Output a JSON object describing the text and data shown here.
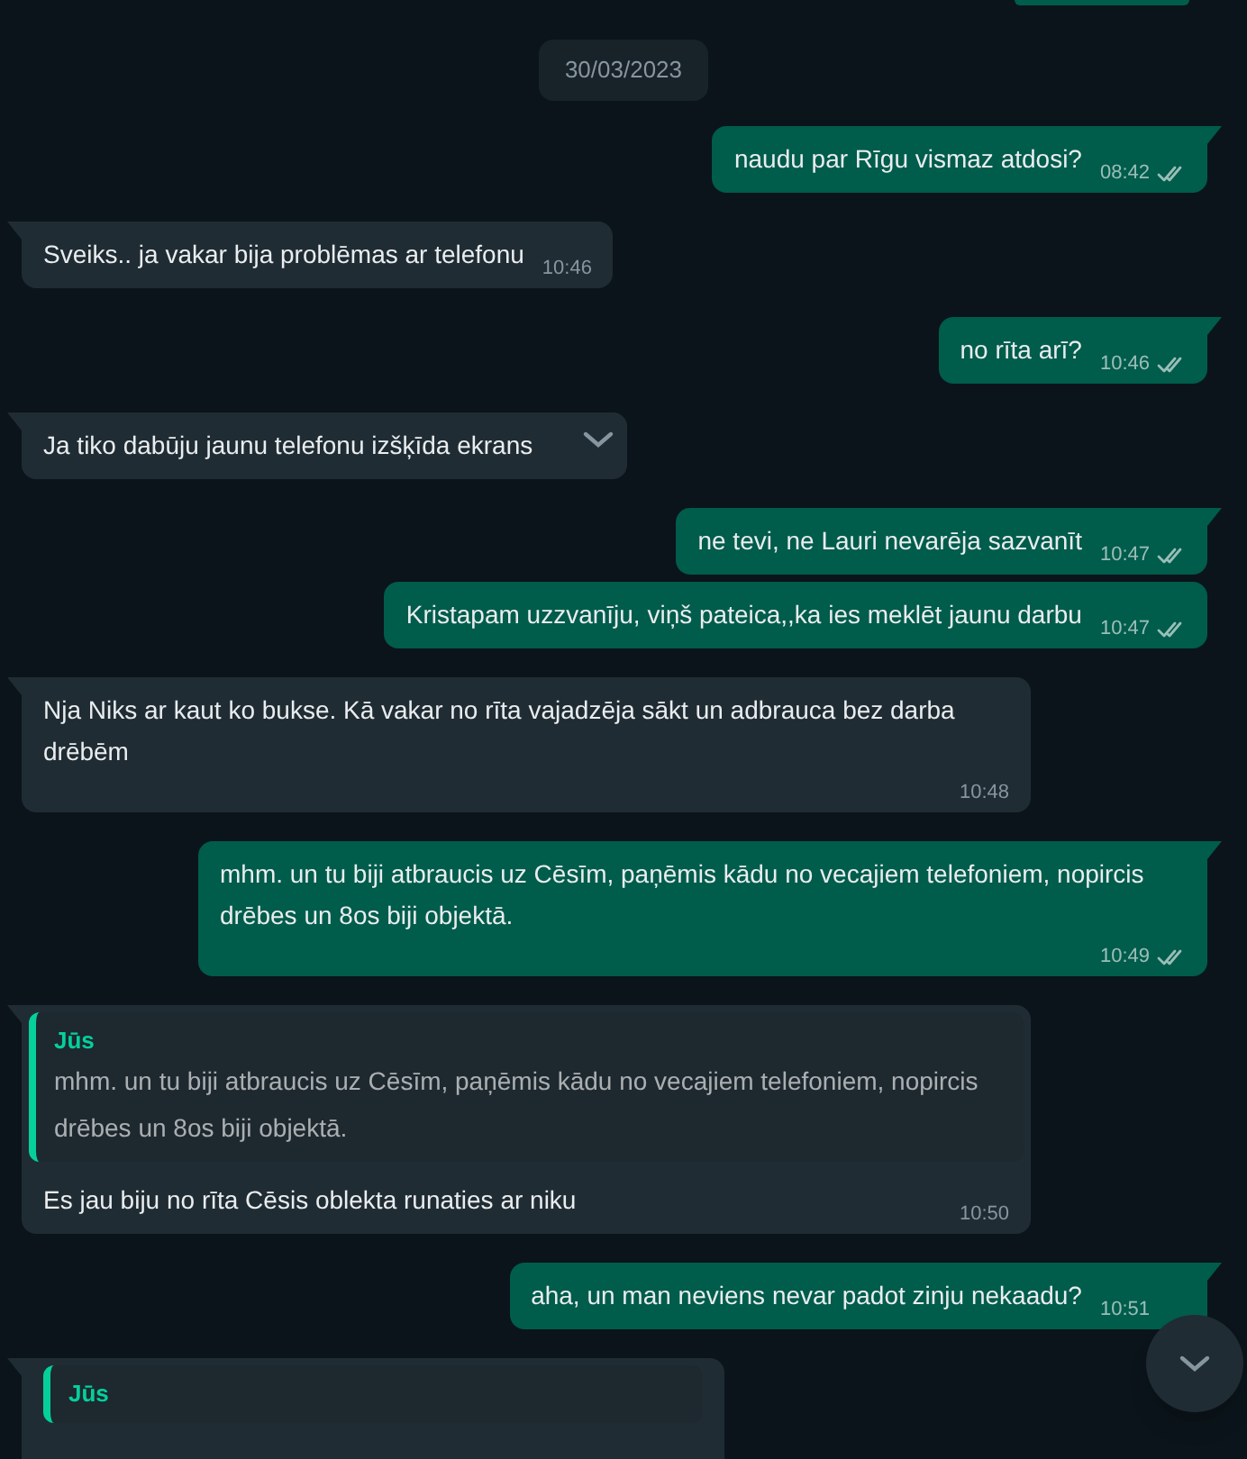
{
  "date_chip": "30/03/2023",
  "messages": [
    {
      "kind": "out",
      "tail": true,
      "text": "naudu par Rīgu vismaz atdosi?",
      "time": "08:42",
      "read": false
    },
    {
      "kind": "in",
      "tail": true,
      "text": "Sveiks.. ja vakar bija problēmas ar telefonu",
      "time": "10:46"
    },
    {
      "kind": "out",
      "tail": true,
      "text": "no rīta arī?",
      "time": "10:46",
      "read": false
    },
    {
      "kind": "in",
      "tail": true,
      "text": "Ja tiko dabūju jaunu telefonu izšķīda ekrans",
      "hovered": true
    },
    {
      "kind": "out",
      "tail": true,
      "text": "ne tevi, ne Lauri nevarēja sazvanīt",
      "time": "10:47",
      "read": false
    },
    {
      "kind": "out",
      "tail": false,
      "text": "Kristapam uzzvanīju, viņš pateica,,ka ies meklēt jaunu darbu",
      "time": "10:47",
      "read": false
    },
    {
      "kind": "in",
      "tail": true,
      "text": "Nja Niks ar kaut ko bukse. Kā vakar no rīta vajadzēja sākt un adbrauca bez darba drēbēm",
      "time": "10:48"
    },
    {
      "kind": "out",
      "tail": true,
      "text": "mhm. un tu biji atbraucis uz Cēsīm, paņēmis kādu no vecajiem telefoniem, nopircis drēbes un 8os biji objektā.",
      "time": "10:49",
      "read": false
    },
    {
      "kind": "in",
      "tail": true,
      "quote": {
        "author": "Jūs",
        "text": "mhm. un tu biji atbraucis uz Cēsīm, paņēmis kādu no vecajiem telefoniem, nopircis drēbes un 8os biji objektā."
      },
      "text": "Es jau biju no rīta Cēsis oblekta runaties ar niku",
      "time": "10:50"
    },
    {
      "kind": "out",
      "tail": true,
      "text": "aha, un man neviens nevar padot zinju nekaadu?",
      "time": "10:51"
    },
    {
      "kind": "in",
      "tail": true,
      "quote": {
        "author": "Jūs"
      }
    }
  ]
}
